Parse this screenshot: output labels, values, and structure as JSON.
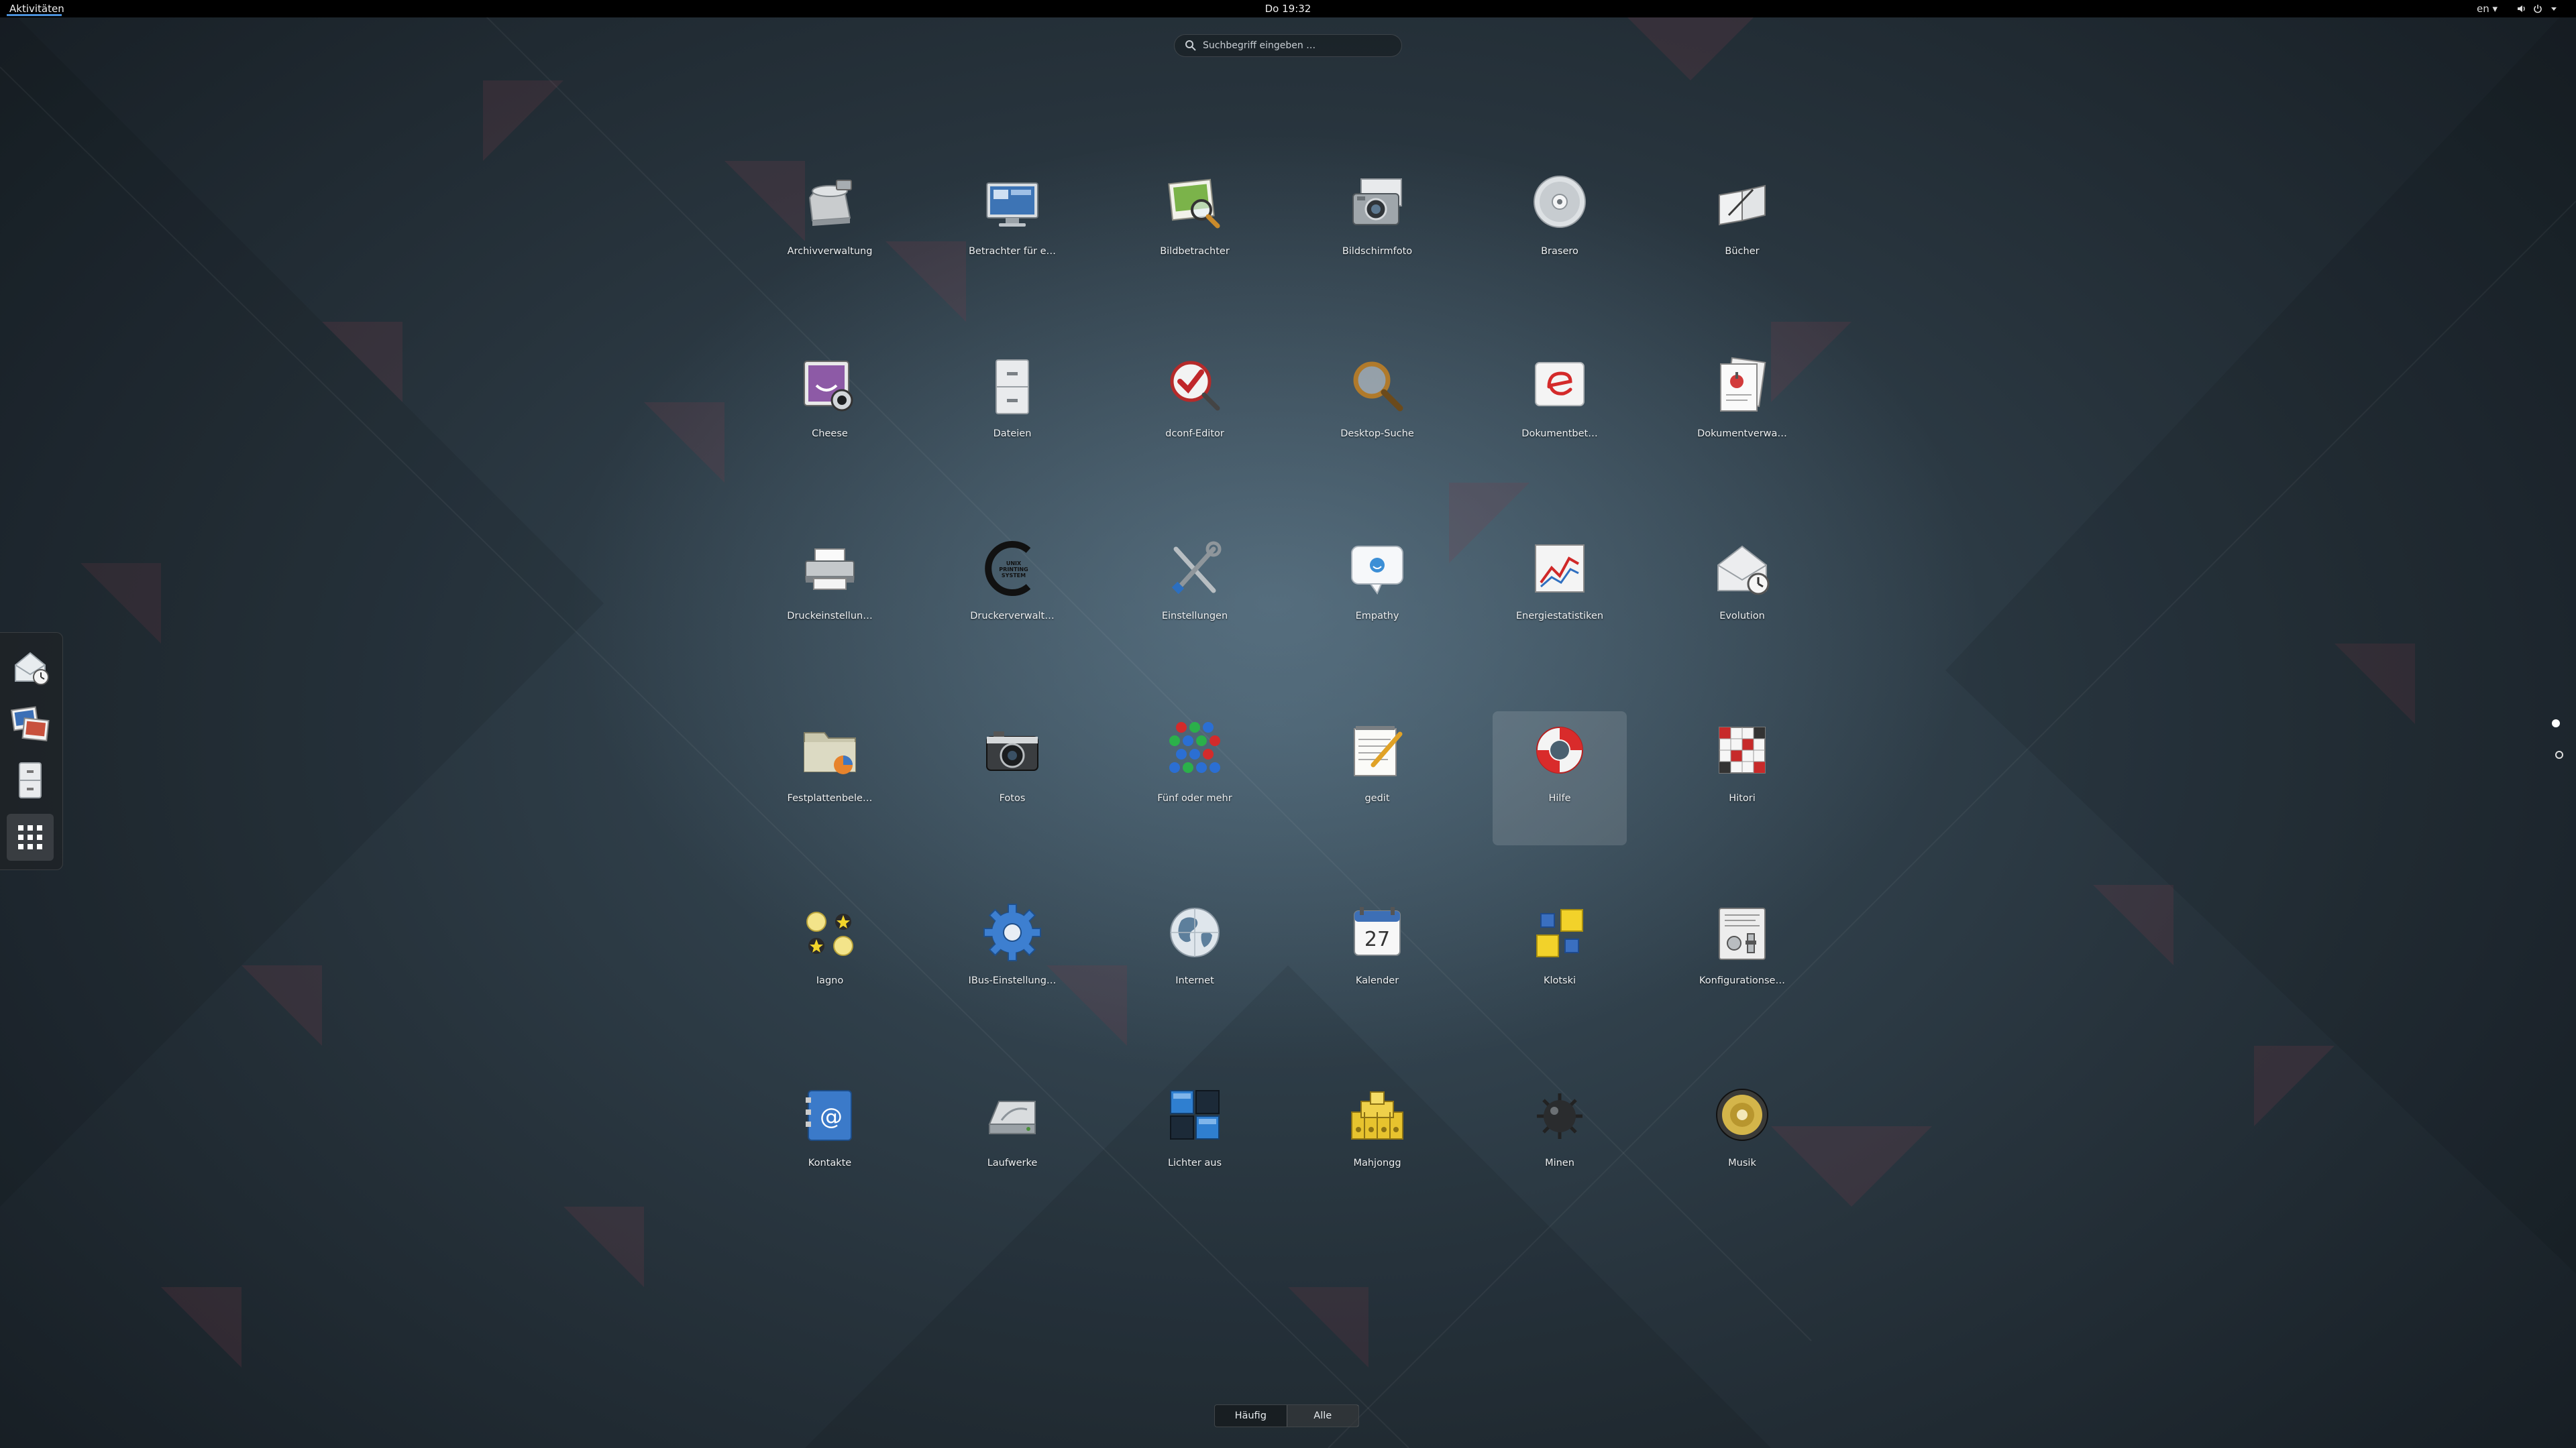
{
  "topbar": {
    "activities_label": "Aktivitäten",
    "clock": "Do 19:32",
    "language": "en ▾"
  },
  "search": {
    "placeholder": "Suchbegriff eingeben …"
  },
  "apps": [
    {
      "label": "Archivverwaltung",
      "icon": "archive-manager-icon"
    },
    {
      "label": "Betrachter für e…",
      "icon": "remote-desktop-viewer-icon"
    },
    {
      "label": "Bildbetrachter",
      "icon": "image-viewer-icon"
    },
    {
      "label": "Bildschirmfoto",
      "icon": "screenshot-icon"
    },
    {
      "label": "Brasero",
      "icon": "disc-burner-icon"
    },
    {
      "label": "Bücher",
      "icon": "books-icon"
    },
    {
      "label": "Cheese",
      "icon": "cheese-webcam-icon"
    },
    {
      "label": "Dateien",
      "icon": "files-cabinet-icon"
    },
    {
      "label": "dconf-Editor",
      "icon": "dconf-editor-icon"
    },
    {
      "label": "Desktop-Suche",
      "icon": "magnifier-icon"
    },
    {
      "label": "Dokumentbet…",
      "icon": "document-viewer-icon"
    },
    {
      "label": "Dokumentverwa…",
      "icon": "document-manager-icon"
    },
    {
      "label": "Druckeinstellun…",
      "icon": "printer-icon"
    },
    {
      "label": "Druckerverwalt…",
      "icon": "cups-icon"
    },
    {
      "label": "Einstellungen",
      "icon": "tools-icon"
    },
    {
      "label": "Empathy",
      "icon": "chat-bubble-icon"
    },
    {
      "label": "Energiestatistiken",
      "icon": "power-statistics-icon"
    },
    {
      "label": "Evolution",
      "icon": "mail-clock-icon"
    },
    {
      "label": "Festplattenbele…",
      "icon": "disk-usage-icon"
    },
    {
      "label": "Fotos",
      "icon": "camera-icon"
    },
    {
      "label": "Fünf oder mehr",
      "icon": "five-or-more-icon"
    },
    {
      "label": "gedit",
      "icon": "text-editor-icon"
    },
    {
      "label": "Hilfe",
      "icon": "lifebuoy-icon"
    },
    {
      "label": "Hitori",
      "icon": "hitori-grid-icon"
    },
    {
      "label": "Iagno",
      "icon": "iagno-stones-icon"
    },
    {
      "label": "IBus-Einstellung…",
      "icon": "gear-icon"
    },
    {
      "label": "Internet",
      "icon": "globe-icon"
    },
    {
      "label": "Kalender",
      "icon": "calendar-icon"
    },
    {
      "label": "Klotski",
      "icon": "klotski-blocks-icon"
    },
    {
      "label": "Konfigurationse…",
      "icon": "config-editor-icon"
    },
    {
      "label": "Kontakte",
      "icon": "contacts-icon"
    },
    {
      "label": "Laufwerke",
      "icon": "drive-icon"
    },
    {
      "label": "Lichter aus",
      "icon": "lights-off-icon"
    },
    {
      "label": "Mahjongg",
      "icon": "mahjongg-tiles-icon"
    },
    {
      "label": "Minen",
      "icon": "mine-icon"
    },
    {
      "label": "Musik",
      "icon": "speaker-icon"
    }
  ],
  "calendar_day": "27",
  "cups_text": "UNIX PRINTING SYSTEM",
  "dash": [
    "evolution-icon",
    "shotwell-icon",
    "files-cabinet-icon",
    "show-apps-grid-icon"
  ],
  "tabs": {
    "frequent": "Häufig",
    "all": "Alle",
    "active": "all"
  },
  "colors": {
    "accent": "#4a90d9",
    "panel": "#000000"
  }
}
